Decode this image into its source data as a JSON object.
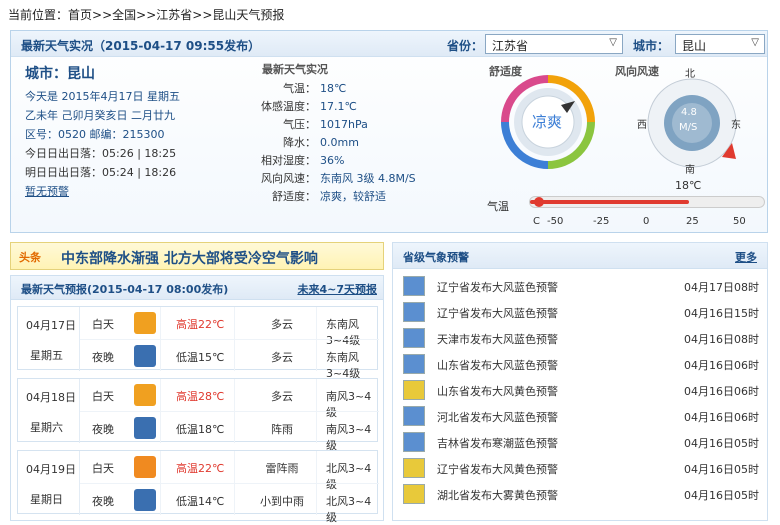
{
  "breadcrumb": {
    "prefix": "当前位置：",
    "items": [
      "首页",
      "全国",
      "江苏省"
    ],
    "current": "昆山天气预报",
    "sep": ">>"
  },
  "live": {
    "title": "最新天气实况（2015-04-17  09:55发布）",
    "province_label": "省份：",
    "province_value": "江苏省",
    "city_label": "城市：",
    "city_value": "昆山",
    "city_name": "城市：昆山",
    "today": "今天是  2015年4月17日  星期五",
    "lunar": "乙未年  己卯月癸亥日  二月廿九",
    "codes": "区号：0520   邮编：215300",
    "sun_today": "今日日出日落：05:26  | 18:25",
    "sun_tomorrow": "明日日出日落：05:24  | 18:26",
    "no_warning": "暂无预警",
    "obs_title": "最新天气实况",
    "obs": [
      {
        "k": "气温：",
        "v": "18℃"
      },
      {
        "k": "体感温度：",
        "v": "17.1℃"
      },
      {
        "k": "气压：",
        "v": "1017hPa"
      },
      {
        "k": "降水：",
        "v": "0.0mm"
      },
      {
        "k": "相对湿度：",
        "v": "36%"
      },
      {
        "k": "风向风速：",
        "v": "东南风 3级 4.8M/S"
      },
      {
        "k": "舒适度：",
        "v": "凉爽，较舒适"
      }
    ],
    "comfort_label": "舒适度",
    "comfort_value": "凉爽",
    "wind_label": "风向风速",
    "compass": {
      "north": "北",
      "south": "南",
      "east": "东",
      "west": "西",
      "speed1": "4.8",
      "speed2": "M/S"
    },
    "temp_label": "气温",
    "temp_value": "18℃",
    "temp_ticks": [
      "C",
      "-50",
      "-25",
      "0",
      "25",
      "50"
    ],
    "temp_fraction": 0.68
  },
  "news": {
    "tag": "头条",
    "text": "中东部降水渐强  北方大部将受冷空气影响"
  },
  "forecast": {
    "title": "最新天气预报(2015-04-17  08:00发布)",
    "more": "未来4~7天预报",
    "days": [
      {
        "date": "04月17日",
        "weekday": "星期五",
        "day": {
          "period": "白天",
          "icon": "partly-cloudy-day-icon",
          "temp": "高温22℃",
          "wx": "多云",
          "wind": "东南风3~4级"
        },
        "night": {
          "period": "夜晚",
          "icon": "partly-cloudy-night-icon",
          "temp": "低温15℃",
          "wx": "多云",
          "wind": "东南风3~4级"
        }
      },
      {
        "date": "04月18日",
        "weekday": "星期六",
        "day": {
          "period": "白天",
          "icon": "partly-cloudy-day-icon",
          "temp": "高温28℃",
          "wx": "多云",
          "wind": "南风3~4级"
        },
        "night": {
          "period": "夜晚",
          "icon": "shower-night-icon",
          "temp": "低温18℃",
          "wx": "阵雨",
          "wind": "南风3~4级"
        }
      },
      {
        "date": "04月19日",
        "weekday": "星期日",
        "day": {
          "period": "白天",
          "icon": "thunder-shower-icon",
          "temp": "高温22℃",
          "wx": "雷阵雨",
          "wind": "北风3~4级"
        },
        "night": {
          "period": "夜晚",
          "icon": "rain-night-icon",
          "temp": "低温14℃",
          "wx": "小到中雨",
          "wind": "北风3~4级"
        }
      }
    ]
  },
  "warnings": {
    "title": "省级气象预警",
    "more": "更多",
    "items": [
      {
        "text": "辽宁省发布大风蓝色预警",
        "time": "04月17日08时",
        "color": "#5b8fd0"
      },
      {
        "text": "辽宁省发布大风蓝色预警",
        "time": "04月16日15时",
        "color": "#5b8fd0"
      },
      {
        "text": "天津市发布大风蓝色预警",
        "time": "04月16日08时",
        "color": "#5b8fd0"
      },
      {
        "text": "山东省发布大风蓝色预警",
        "time": "04月16日06时",
        "color": "#5b8fd0"
      },
      {
        "text": "山东省发布大风黄色预警",
        "time": "04月16日06时",
        "color": "#e8c93a"
      },
      {
        "text": "河北省发布大风蓝色预警",
        "time": "04月16日06时",
        "color": "#5b8fd0"
      },
      {
        "text": "吉林省发布寒潮蓝色预警",
        "time": "04月16日05时",
        "color": "#5b8fd0"
      },
      {
        "text": "辽宁省发布大风黄色预警",
        "time": "04月16日05时",
        "color": "#e8c93a"
      },
      {
        "text": "湖北省发布大雾黄色预警",
        "time": "04月16日05时",
        "color": "#e8c93a"
      }
    ]
  }
}
